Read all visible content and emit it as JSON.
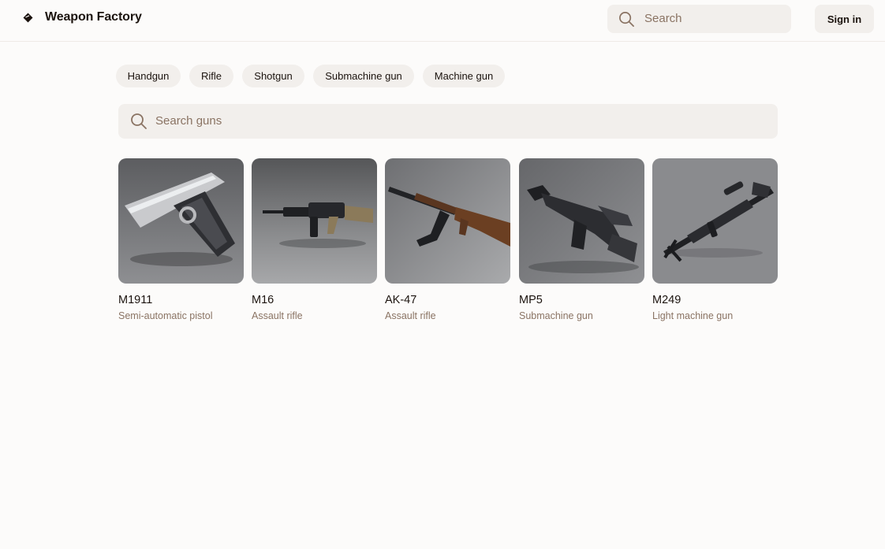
{
  "header": {
    "brand": "Weapon Factory",
    "logo_icon": "diamond-logo-icon",
    "search_placeholder": "Search",
    "sign_in_label": "Sign in"
  },
  "categories": [
    "Handgun",
    "Rifle",
    "Shotgun",
    "Submachine gun",
    "Machine gun"
  ],
  "gun_search": {
    "placeholder": "Search guns"
  },
  "guns": [
    {
      "name": "M1911",
      "type": "Semi-automatic pistol"
    },
    {
      "name": "M16",
      "type": "Assault rifle"
    },
    {
      "name": "AK-47",
      "type": "Assault rifle"
    },
    {
      "name": "MP5",
      "type": "Submachine gun"
    },
    {
      "name": "M249",
      "type": "Light machine gun"
    }
  ],
  "colors": {
    "background": "#fcfbfa",
    "chip_bg": "#f2efec",
    "text": "#1b130e",
    "muted_text": "#8a7363"
  }
}
